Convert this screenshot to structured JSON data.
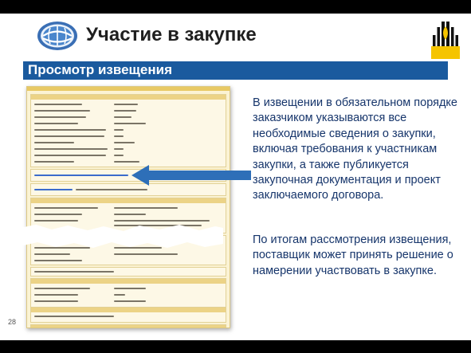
{
  "header": {
    "title": "Участие в закупке",
    "subtitle": "Просмотр извещения"
  },
  "colors": {
    "subbar": "#1a5a9e",
    "text": "#16356b",
    "logo_yellow": "#f5c400",
    "arrow": "#2e6fb8"
  },
  "icons": {
    "left_logo": "globe-logo-icon",
    "right_logo": "rosneft-logo-icon",
    "arrow": "left-arrow-icon"
  },
  "body": {
    "paragraph1": "В извещении в обязательном порядке заказчиком указываются все необходимые сведения о закупки, включая требования к участникам закупки, а также публикуется закупочная документация и проект заключаемого договора.",
    "paragraph2": "По итогам рассмотрения извещения, поставщик может принять решение о намерении участвовать в закупке."
  },
  "footer": {
    "page_number": "28"
  }
}
